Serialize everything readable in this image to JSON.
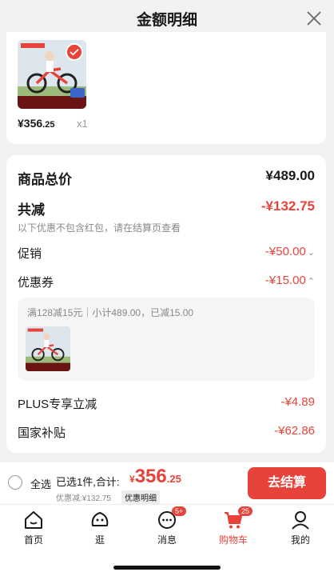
{
  "header": {
    "title": "金额明细",
    "close_icon": "close-icon"
  },
  "product": {
    "price_int": "¥356",
    "price_dec": ".25",
    "quantity": "x1",
    "image_icon": "bicycle-product-image",
    "selected": true
  },
  "summary": {
    "total_label": "商品总价",
    "total_value": "¥489.00",
    "reduce_label": "共减",
    "reduce_value": "-¥132.75",
    "note": "以下优惠不包含红包，请在结算页查看",
    "promo_label": "促销",
    "promo_value": "-¥50.00",
    "coupon_label": "优惠券",
    "coupon_value": "-¥15.00",
    "coupon_detail": "满128减15元｜小计489.00，已减15.00",
    "plus_label": "PLUS专享立减",
    "plus_value": "-¥4.89",
    "subsidy_label": "国家补贴",
    "subsidy_value": "-¥62.86"
  },
  "bottom_bar": {
    "select_all": "全选",
    "selected_text": "已选1件,合计:",
    "total_sym": "¥",
    "total_int": "356",
    "total_dec": ".25",
    "discount_text": "优惠减:¥132.75",
    "discount_detail": "优惠明细",
    "checkout": "去结算"
  },
  "tabs": [
    {
      "label": "首页",
      "icon": "home-icon"
    },
    {
      "label": "逛",
      "icon": "browse-icon"
    },
    {
      "label": "消息",
      "icon": "message-icon",
      "badge": "5+"
    },
    {
      "label": "购物车",
      "icon": "cart-icon",
      "badge": "25",
      "active": true
    },
    {
      "label": "我的",
      "icon": "profile-icon"
    }
  ],
  "colors": {
    "accent": "#e8433a",
    "text": "#1a1a1a",
    "muted": "#888888"
  }
}
